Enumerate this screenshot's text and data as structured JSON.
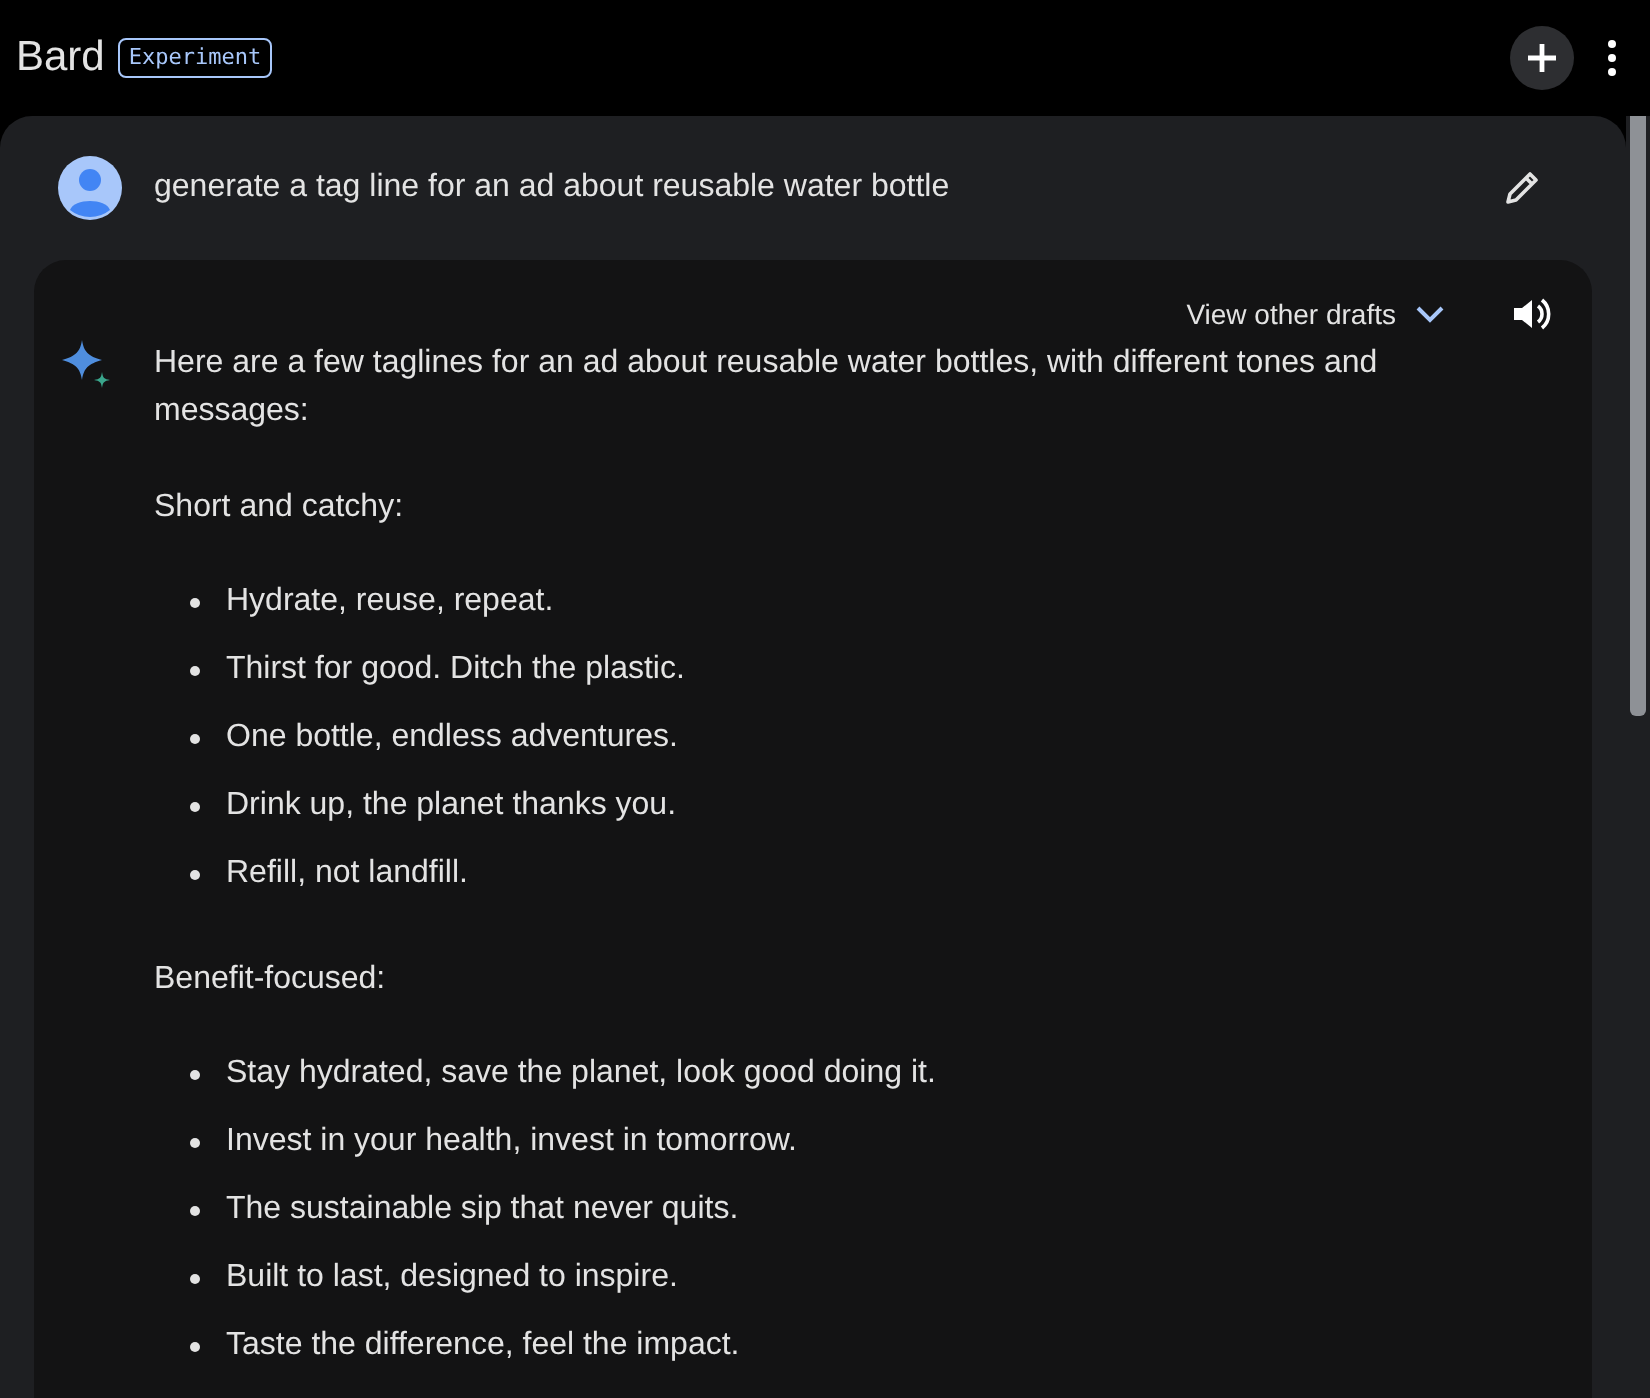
{
  "header": {
    "title": "Bard",
    "badge": "Experiment"
  },
  "prompt": {
    "text": "generate a tag line for an ad about reusable water bottle"
  },
  "response": {
    "drafts_button": "View other drafts",
    "intro": "Here are a few taglines for an ad about reusable water bottles, with different tones and messages:",
    "sections": [
      {
        "heading": "Short and catchy:",
        "items": [
          "Hydrate, reuse, repeat.",
          "Thirst for good. Ditch the plastic.",
          "One bottle, endless adventures.",
          "Drink up, the planet thanks you.",
          "Refill, not landfill."
        ]
      },
      {
        "heading": "Benefit-focused:",
        "items": [
          "Stay hydrated, save the planet, look good doing it.",
          "Invest in your health, invest in tomorrow.",
          "The sustainable sip that never quits.",
          "Built to last, designed to inspire.",
          "Taste the difference, feel the impact."
        ]
      }
    ]
  }
}
